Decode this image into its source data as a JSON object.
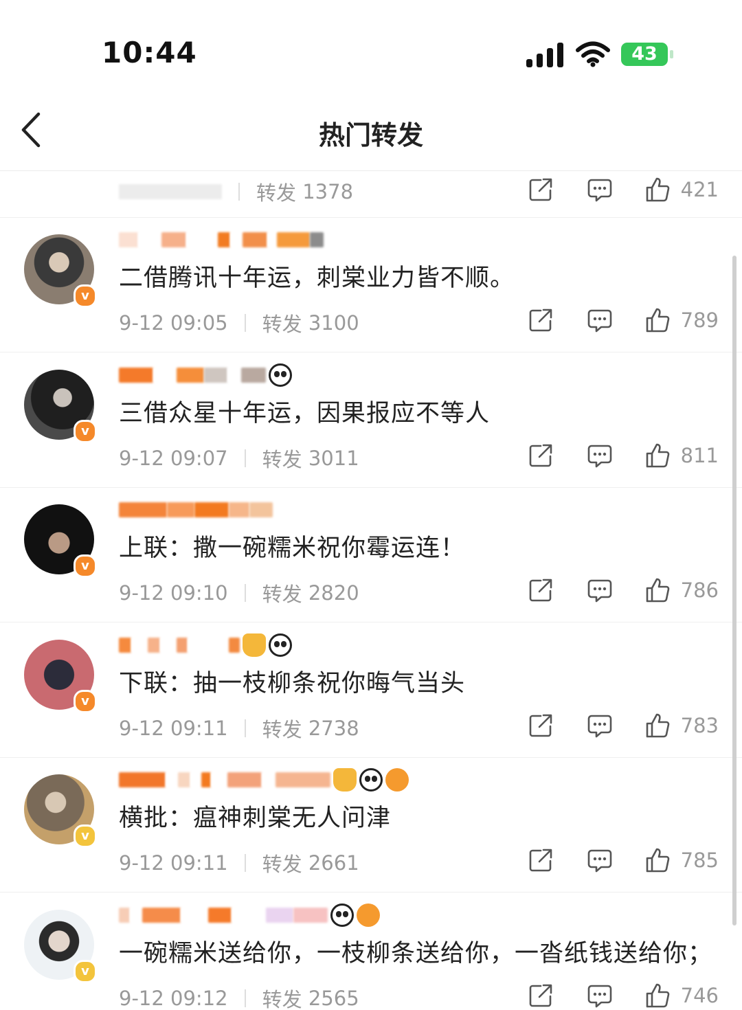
{
  "status_bar": {
    "time": "10:44",
    "battery": "43"
  },
  "nav": {
    "title": "热门转发"
  },
  "partial_row": {
    "repost_label": "转发",
    "repost_count": "1378",
    "likes": "421"
  },
  "posts": [
    {
      "text": "二借腾讯十年运，刺棠业力皆不顺。",
      "date": "9-12 09:05",
      "repost_label": "转发",
      "repost_count": "3100",
      "likes": "789"
    },
    {
      "text": "三借众星十年运，因果报应不等人",
      "date": "9-12 09:07",
      "repost_label": "转发",
      "repost_count": "3011",
      "likes": "811"
    },
    {
      "text": "上联：撒一碗糯米祝你霉运连！",
      "date": "9-12 09:10",
      "repost_label": "转发",
      "repost_count": "2820",
      "likes": "786"
    },
    {
      "text": "下联：抽一枝柳条祝你晦气当头",
      "date": "9-12 09:11",
      "repost_label": "转发",
      "repost_count": "2738",
      "likes": "783"
    },
    {
      "text": "横批：瘟神刺棠无人问津",
      "date": "9-12 09:11",
      "repost_label": "转发",
      "repost_count": "2661",
      "likes": "785"
    },
    {
      "text": "一碗糯米送给你，一枝柳条送给你，一沓纸钱送给你；",
      "date": "9-12 09:12",
      "repost_label": "转发",
      "repost_count": "2565",
      "likes": "746"
    }
  ],
  "badge": {
    "letter": "v"
  },
  "colors": {
    "badge_orange": "#f5892a",
    "badge_gold": "#f3c43c",
    "meta_gray": "#999999",
    "battery_green": "#35c759"
  },
  "icons": [
    "back-icon",
    "share-icon",
    "comment-icon",
    "like-icon",
    "cellular-icon",
    "wifi-icon",
    "battery-icon"
  ]
}
